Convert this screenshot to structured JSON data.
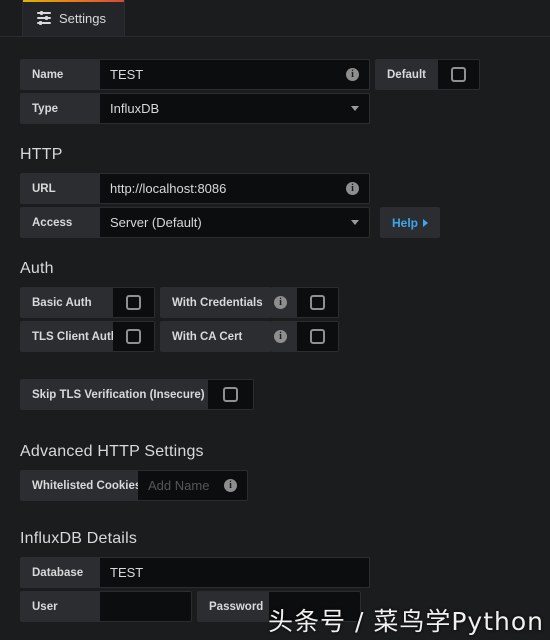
{
  "tab": {
    "label": "Settings",
    "icon": "sliders-icon"
  },
  "colors": {
    "background": "#1b1c1e",
    "label_cell": "#2c2d31",
    "input_cell": "#0c0d0e",
    "accent_link": "#3ba8e8",
    "tab_gradient_start": "#e0b400",
    "tab_gradient_mid": "#eb7b18",
    "tab_gradient_end": "#d44a3a",
    "text": "#d8d9da",
    "placeholder": "#55565a"
  },
  "basic": {
    "name_label": "Name",
    "name_value": "TEST",
    "default_label": "Default",
    "type_label": "Type",
    "type_value": "InfluxDB"
  },
  "http": {
    "title": "HTTP",
    "url_label": "URL",
    "url_value": "http://localhost:8086",
    "access_label": "Access",
    "access_value": "Server (Default)",
    "help_label": "Help"
  },
  "auth": {
    "title": "Auth",
    "basic_auth_label": "Basic Auth",
    "with_credentials_label": "With Credentials",
    "tls_client_auth_label": "TLS Client Auth",
    "with_ca_cert_label": "With CA Cert",
    "skip_tls_label": "Skip TLS Verification (Insecure)"
  },
  "advanced": {
    "title": "Advanced HTTP Settings",
    "cookies_label": "Whitelisted Cookies",
    "cookies_placeholder": "Add Name"
  },
  "influx": {
    "title": "InfluxDB Details",
    "database_label": "Database",
    "database_value": "TEST",
    "user_label": "User",
    "user_value": "",
    "password_label": "Password",
    "password_value": ""
  },
  "watermark": {
    "text": "头条号 / 菜鸟学Python"
  }
}
